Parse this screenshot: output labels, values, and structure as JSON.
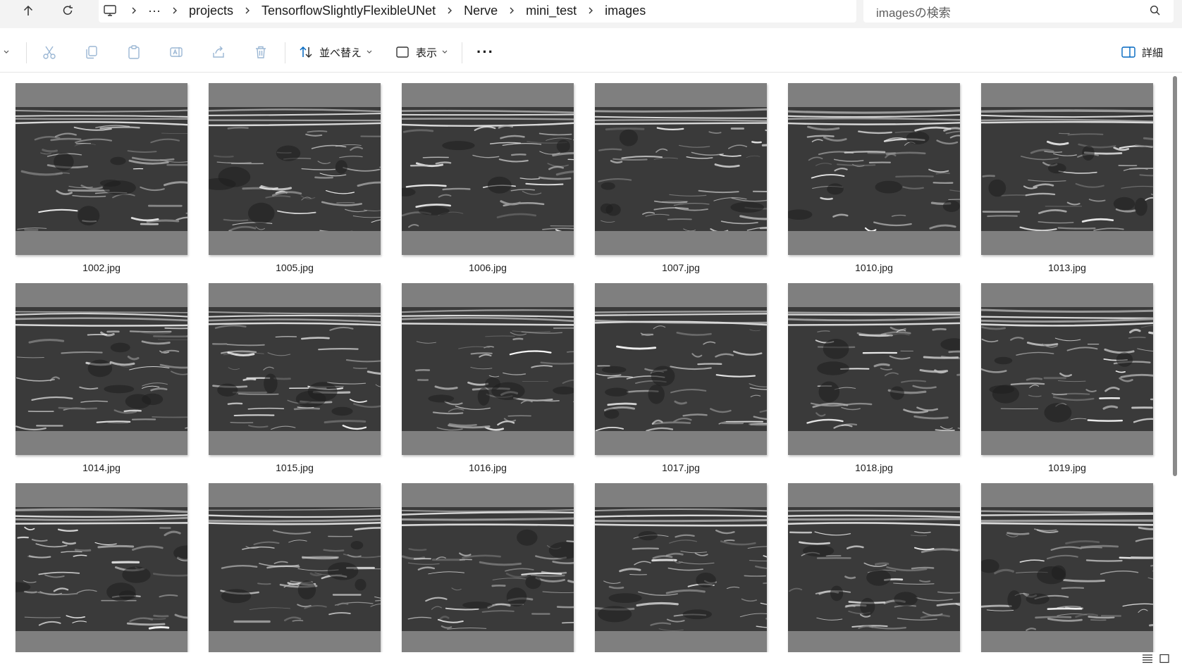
{
  "nav": {
    "up_icon": "arrow-up-icon",
    "refresh_icon": "refresh-icon"
  },
  "address": {
    "overflow": "···",
    "crumbs": [
      "projects",
      "TensorflowSlightlyFlexibleUNet",
      "Nerve",
      "mini_test",
      "images"
    ]
  },
  "search": {
    "placeholder": "imagesの検索"
  },
  "toolbar": {
    "sort_label": "並べ替え",
    "view_label": "表示",
    "more_label": "···",
    "details_label": "詳細"
  },
  "files": [
    {
      "name": "1002.jpg"
    },
    {
      "name": "1005.jpg"
    },
    {
      "name": "1006.jpg"
    },
    {
      "name": "1007.jpg"
    },
    {
      "name": "1010.jpg"
    },
    {
      "name": "1013.jpg"
    },
    {
      "name": "1014.jpg"
    },
    {
      "name": "1015.jpg"
    },
    {
      "name": "1016.jpg"
    },
    {
      "name": "1017.jpg"
    },
    {
      "name": "1018.jpg"
    },
    {
      "name": "1019.jpg"
    },
    {
      "name": ""
    },
    {
      "name": ""
    },
    {
      "name": ""
    },
    {
      "name": ""
    },
    {
      "name": ""
    },
    {
      "name": ""
    }
  ],
  "colors": {
    "thumb_pad": "#7f7f7f",
    "accent": "#0067c0"
  }
}
